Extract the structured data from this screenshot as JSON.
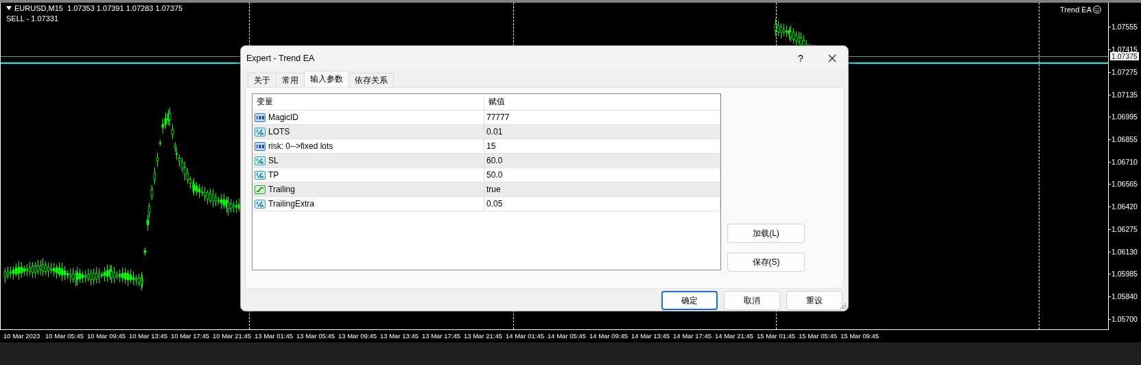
{
  "chart": {
    "symbol_line": "EURUSD,M15  1.07353 1.07391 1.07283 1.07375",
    "order_line": "SELL - 1.07331",
    "expert_label": "Trend EA",
    "current_price": "1.07375",
    "price_axis": [
      "1.07555",
      "1.07415",
      "1.07275",
      "1.07135",
      "1.06995",
      "1.06855",
      "1.06710",
      "1.06565",
      "1.06420",
      "1.06275",
      "1.06130",
      "1.05985",
      "1.05840",
      "1.05700"
    ],
    "time_axis": [
      "10 Mar 2023",
      "10 Mar 05:45",
      "10 Mar 09:45",
      "10 Mar 13:45",
      "10 Mar 17:45",
      "10 Mar 21:45",
      "13 Mar 01:45",
      "13 Mar 05:45",
      "13 Mar 09:45",
      "13 Mar 13:45",
      "13 Mar 17:45",
      "13 Mar 21:45",
      "14 Mar 01:45",
      "14 Mar 05:45",
      "14 Mar 09:45",
      "14 Mar 13:45",
      "14 Mar 17:45",
      "14 Mar 21:45",
      "15 Mar 01:45",
      "15 Mar 05:45",
      "15 Mar 09:45"
    ]
  },
  "dialog": {
    "title": "Expert - Trend EA",
    "help": "?",
    "tabs": [
      {
        "label": "关于",
        "selected": false
      },
      {
        "label": "常用",
        "selected": false
      },
      {
        "label": "输入参数",
        "selected": true
      },
      {
        "label": "依存关系",
        "selected": false
      }
    ],
    "table": {
      "columns": [
        "变量",
        "赋值"
      ],
      "rows": [
        {
          "kind": "int",
          "name": "MagicID",
          "value": "77777"
        },
        {
          "kind": "double",
          "name": "LOTS",
          "value": "0.01"
        },
        {
          "kind": "int",
          "name": "risk: 0-->fixed lots",
          "value": "15"
        },
        {
          "kind": "double",
          "name": "SL",
          "value": "60.0"
        },
        {
          "kind": "double",
          "name": "TP",
          "value": "50.0"
        },
        {
          "kind": "bool",
          "name": "Trailing",
          "value": "true"
        },
        {
          "kind": "double",
          "name": "TrailingExtra",
          "value": "0.05"
        }
      ]
    },
    "side_buttons": [
      "加载(L)",
      "保存(S)"
    ],
    "buttons": [
      {
        "label": "确定",
        "selected": true
      },
      {
        "label": "取消",
        "selected": false
      },
      {
        "label": "重设",
        "selected": false
      }
    ]
  }
}
